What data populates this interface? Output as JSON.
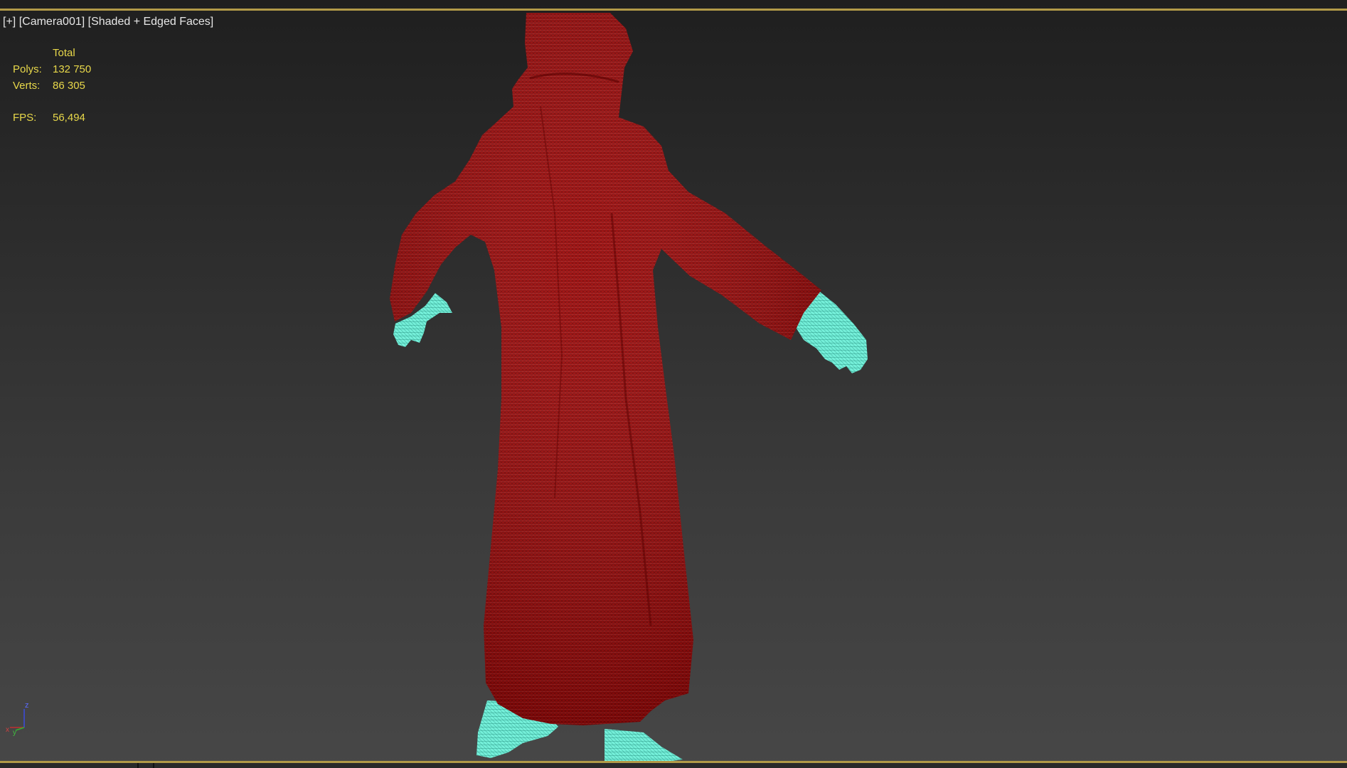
{
  "viewport": {
    "label_plus": "[+]",
    "label_camera": "[Camera001]",
    "label_mode": "[Shaded + Edged Faces]",
    "stats": {
      "header": "Total",
      "polys_label": "Polys:",
      "polys_value": "132 750",
      "verts_label": "Verts:",
      "verts_value": "86 305",
      "fps_label": "FPS:",
      "fps_value": "56,494"
    },
    "axis": {
      "z": "z",
      "x": "x",
      "y": "y"
    }
  },
  "colors": {
    "robe": "#8e0000",
    "skin": "#66e8d2",
    "accent_border": "#b29a48",
    "stats_text": "#e8d84a"
  }
}
